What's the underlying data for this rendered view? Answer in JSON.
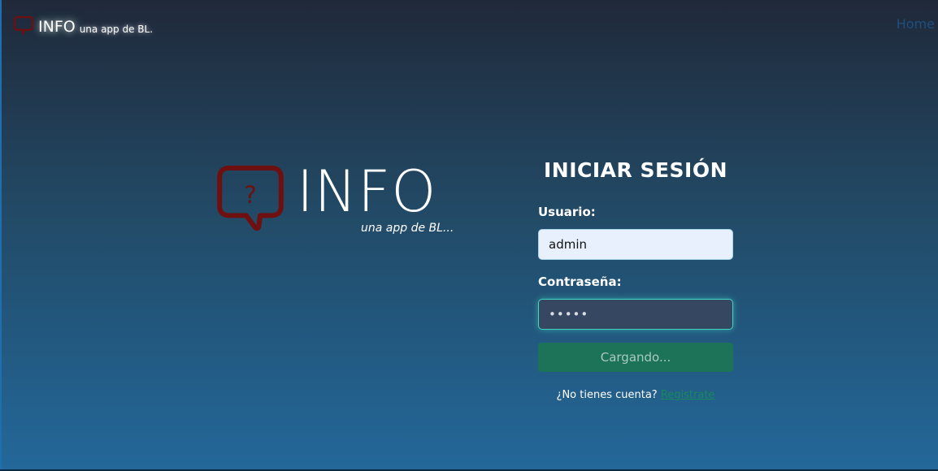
{
  "navbar": {
    "brand_title": "INFO",
    "brand_subtitle": "una app de  BL.",
    "home_link": "Home"
  },
  "logo": {
    "title": "INFO",
    "subtitle": "una app de BL...",
    "icon": "speech-bubble-question-icon",
    "icon_color": "#6e1010"
  },
  "login": {
    "title": "INICIAR SESIÓN",
    "username_label": "Usuario:",
    "username_value": "admin",
    "password_label": "Contraseña:",
    "password_value": "•••••",
    "submit_label": "Cargando...",
    "signup_prompt": "¿No tienes cuenta?",
    "signup_link": "Registrate"
  },
  "colors": {
    "background_top": "#20293a",
    "background_bottom": "#23689a",
    "button": "#1c7358",
    "focus_border": "#3fd6c0",
    "link": "#178a5c"
  }
}
